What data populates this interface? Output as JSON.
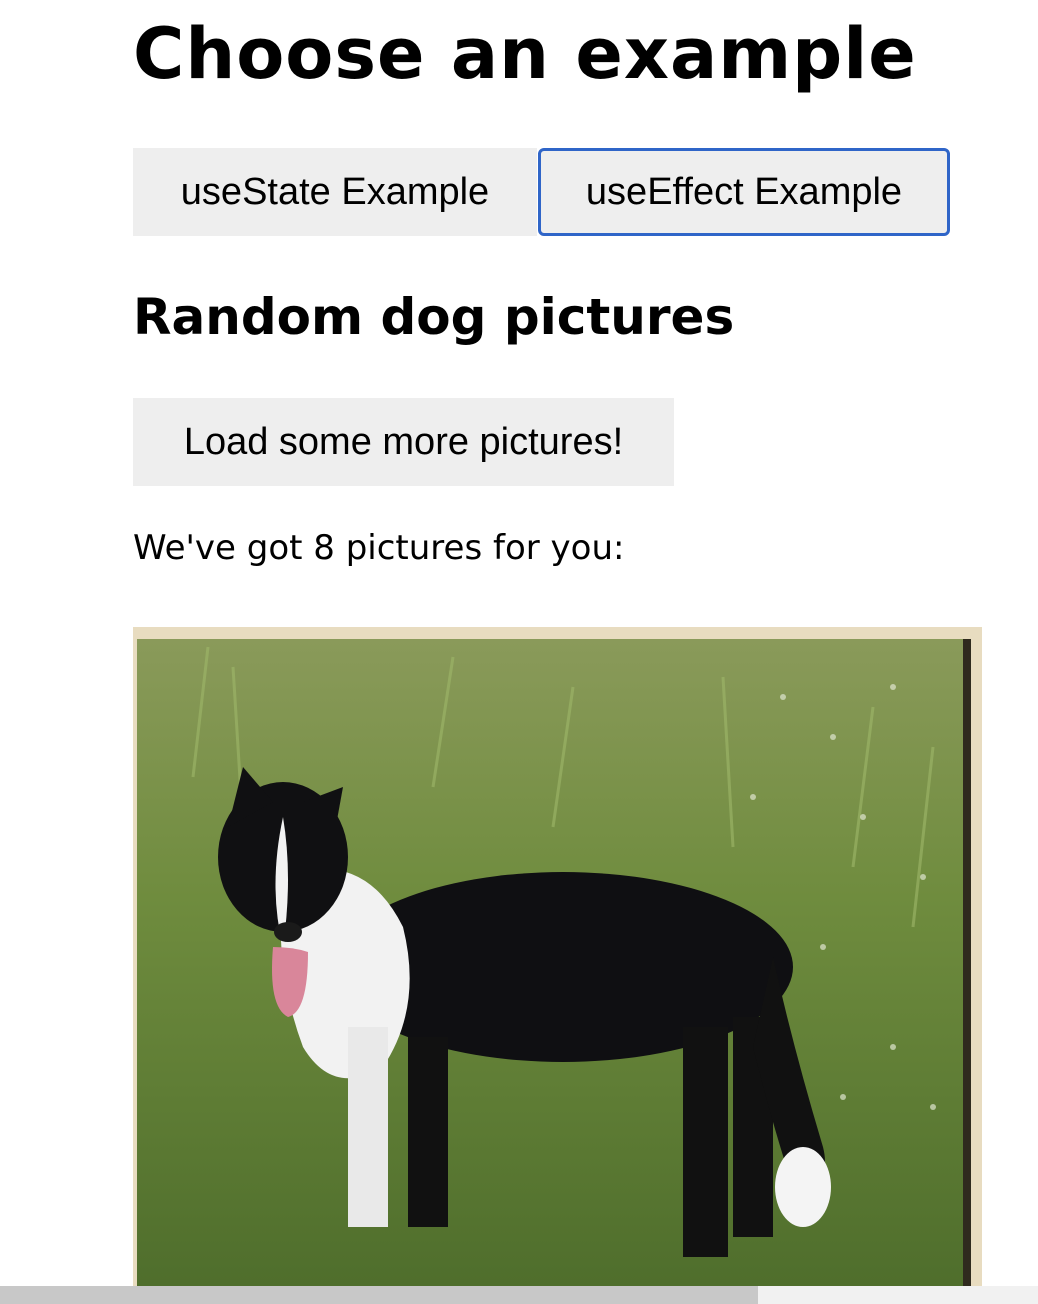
{
  "page": {
    "title": "Choose an example"
  },
  "tabs": [
    {
      "label": "useState Example"
    },
    {
      "label": "useEffect Example"
    }
  ],
  "section": {
    "heading": "Random dog pictures",
    "load_button_label": "Load some more pictures!",
    "count_text": "We've got 8 pictures for you:"
  },
  "colors": {
    "button_bg": "#eeeeee",
    "focus_border": "#2f65c8"
  },
  "scrollbar": {
    "thumb_fraction": 0.73
  }
}
